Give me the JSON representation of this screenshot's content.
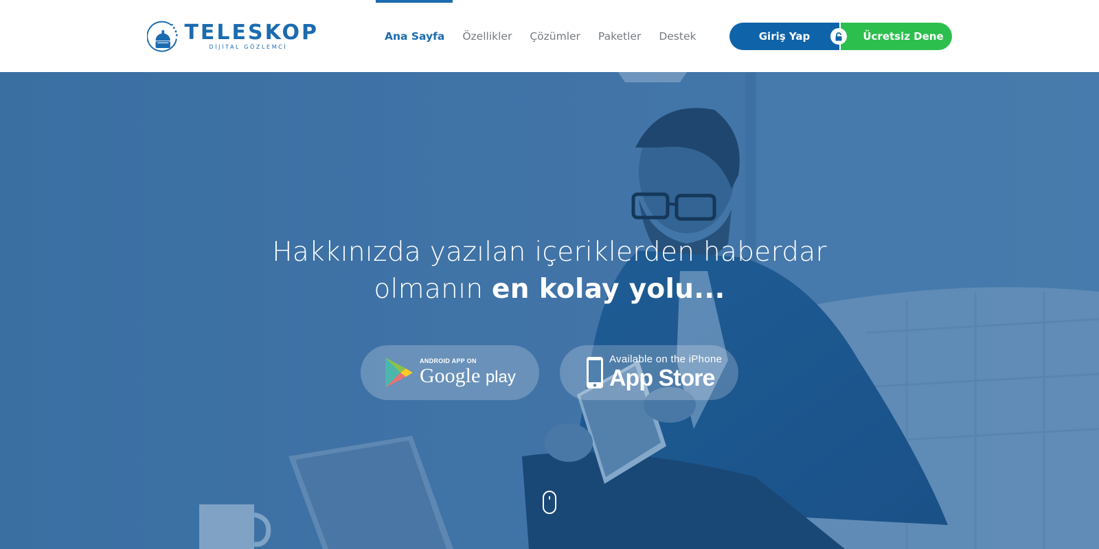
{
  "header": {
    "logo": {
      "word": "TELESKOP",
      "tagline": "DİJİTAL GÖZLEMCİ"
    },
    "nav": [
      {
        "label": "Ana Sayfa",
        "active": true
      },
      {
        "label": "Özellikler",
        "active": false
      },
      {
        "label": "Çözümler",
        "active": false
      },
      {
        "label": "Paketler",
        "active": false
      },
      {
        "label": "Destek",
        "active": false
      }
    ],
    "login_label": "Giriş Yap",
    "trial_label": "Ücretsiz Dene"
  },
  "hero": {
    "headline_line1": "Hakkınızda yazılan içeriklerden haberdar",
    "headline_line2_regular": "olmanın ",
    "headline_line2_bold": "en kolay yolu...",
    "google_play": {
      "small": "ANDROID APP ON",
      "big_left": "Google",
      "big_right": "play"
    },
    "app_store": {
      "small": "Available on the iPhone",
      "big": "App Store"
    }
  },
  "colors": {
    "brand_blue": "#1b6bb0",
    "login_blue": "#0f63a8",
    "trial_green": "#2cbf4e",
    "nav_gray": "#757b82",
    "hero_tint": "#4b7fae"
  },
  "icons": [
    "telescope-logo-icon",
    "lock-icon",
    "google-play-icon",
    "iphone-icon",
    "mouse-scroll-icon"
  ]
}
